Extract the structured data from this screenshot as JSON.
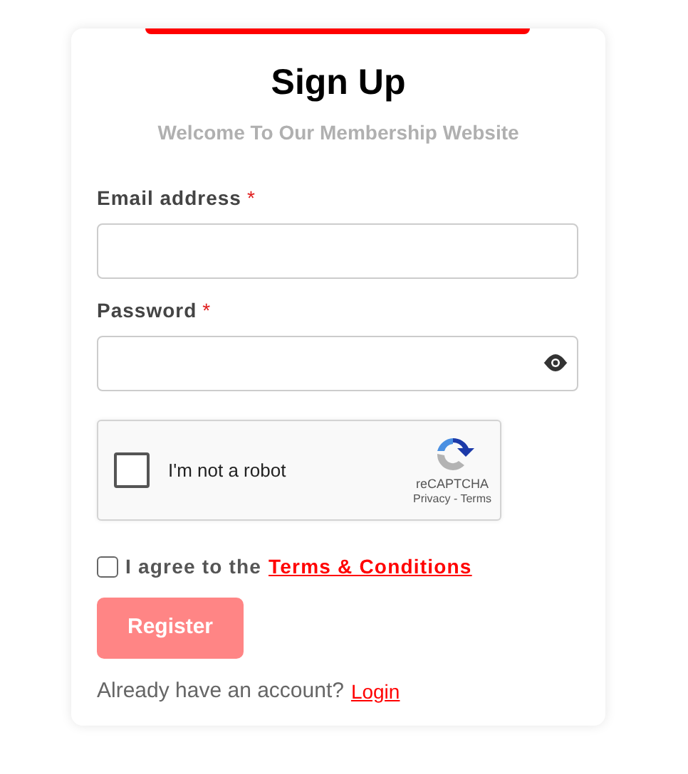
{
  "title": "Sign Up",
  "subtitle": "Welcome To Our Membership Website",
  "fields": [
    {
      "label": "Email address",
      "required_mark": "*",
      "kind": "text"
    },
    {
      "label": "Password",
      "required_mark": "*",
      "kind": "password"
    }
  ],
  "captcha": {
    "label": "I'm not a robot",
    "checked": false,
    "brand": "reCAPTCHA",
    "links": "Privacy - Terms"
  },
  "agree": {
    "text": "I agree to the",
    "link": "Terms & Conditions",
    "checked": false
  },
  "register_button": {
    "label": "Register",
    "disabled": true
  },
  "footer": {
    "text": "Already have an account?",
    "link": "Login"
  }
}
